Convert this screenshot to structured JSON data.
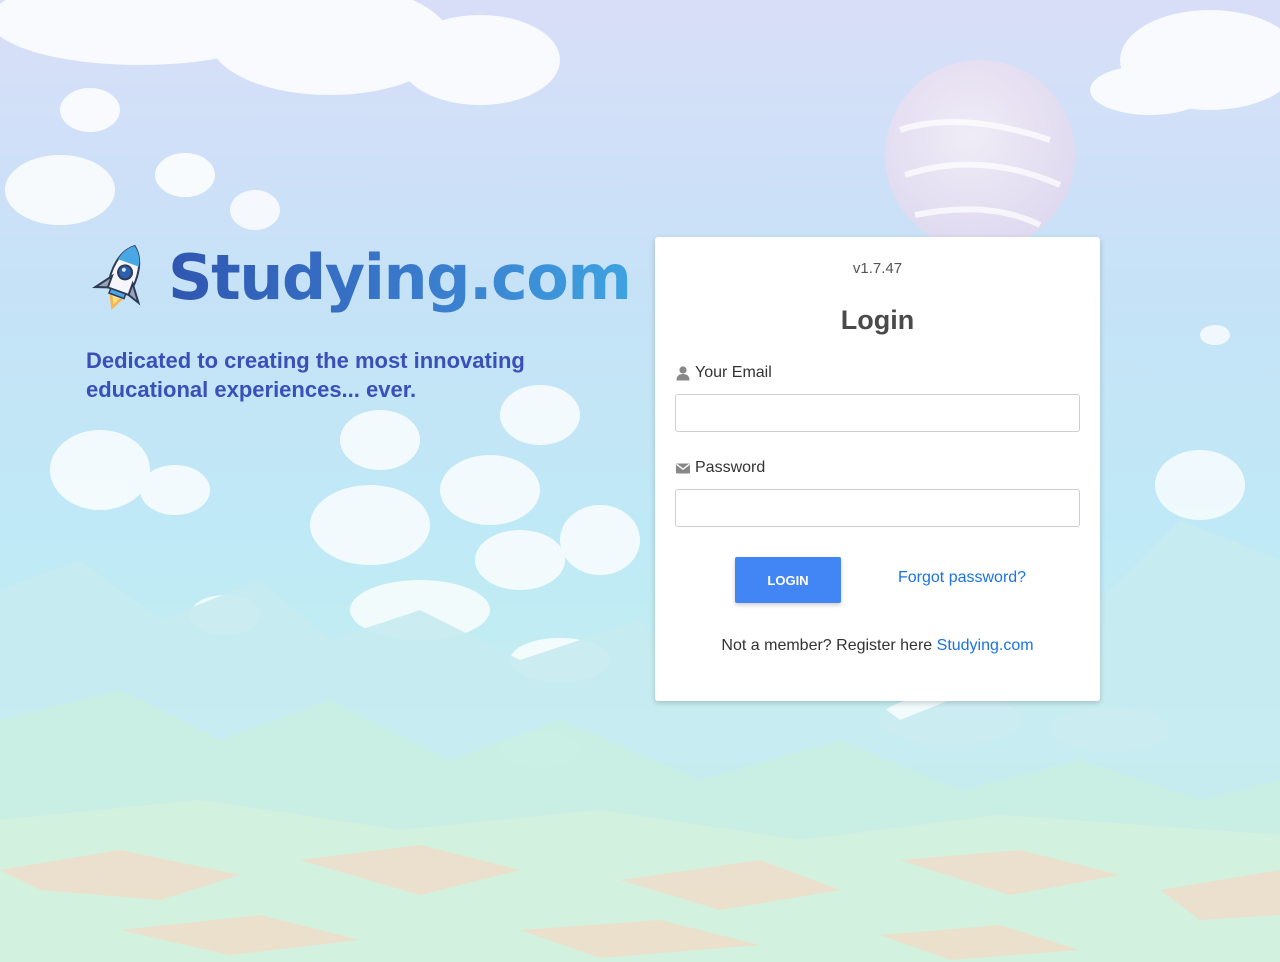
{
  "brand": {
    "name": "Studying.com",
    "tagline": "Dedicated to creating the most innovating educational experiences... ever."
  },
  "login": {
    "version": "v1.7.47",
    "title": "Login",
    "email_label": "Your Email",
    "email_value": "",
    "password_label": "Password",
    "password_value": "",
    "login_button": "LOGIN",
    "forgot_password": "Forgot password?",
    "register_prompt": "Not a member? Register here",
    "register_link": "Studying.com"
  },
  "icons": {
    "email_label_icon": "user-icon",
    "password_label_icon": "envelope-icon",
    "logo_icon": "rocket-icon"
  },
  "colors": {
    "brand_blue": "#3a50b8",
    "primary_button": "#4285f4",
    "link": "#1a73e8"
  }
}
